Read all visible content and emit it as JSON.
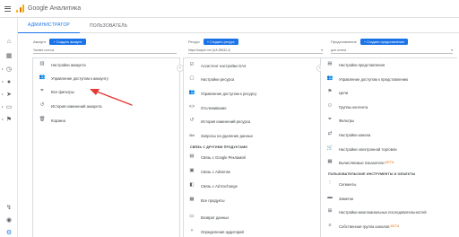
{
  "app": {
    "title": "Google Аналитика"
  },
  "tabs": [
    {
      "label": "АДМИНИСТРАТОР"
    },
    {
      "label": "ПОЛЬЗОВАТЕЛЬ"
    }
  ],
  "columns": {
    "account": {
      "label": "Аккаунт",
      "create_label": "Создать аккаунт",
      "selector": "Yandex.com.ua",
      "items": [
        {
          "label": "Настройки аккаунта",
          "icon": "building-icon"
        },
        {
          "label": "Управление доступом к аккаунту",
          "icon": "people-icon"
        },
        {
          "label": "Все фильтры",
          "icon": "filter-icon"
        },
        {
          "label": "История изменений аккаунта",
          "icon": "history-icon"
        },
        {
          "label": "Корзина",
          "icon": "trash-icon"
        }
      ]
    },
    "property": {
      "label": "Ресурс",
      "create_label": "Создать ресурс",
      "selector": "https://kazpm.net (UA-98432-2)",
      "items": [
        {
          "label": "Ассистент настройки GA4",
          "icon": "check-square-icon"
        },
        {
          "label": "Настройки ресурса",
          "icon": "square-icon"
        },
        {
          "label": "Управление доступом к ресурсу",
          "icon": "people-icon"
        },
        {
          "label": "Отслеживание",
          "icon": "code-icon"
        },
        {
          "label": "История изменений ресурса",
          "icon": "history-icon"
        },
        {
          "label": "Запросы на удаление данных",
          "icon": "dd-icon"
        }
      ],
      "section_title": "СВЯЗЬ С ДРУГИМИ ПРОДУКТАМИ",
      "linked_items": [
        {
          "label": "Связь с Google Рекламой",
          "icon": "ads-icon"
        },
        {
          "label": "Связь с AdSense",
          "icon": "adsense-icon"
        },
        {
          "label": "Связь с Ad Exchange",
          "icon": "ad-exchange-icon"
        },
        {
          "label": "Все продукты",
          "icon": "grid-icon"
        }
      ],
      "bottom_items": [
        {
          "label": "Возврат данных",
          "icon": "data-return-icon"
        },
        {
          "label": "Определения аудиторий",
          "icon": "audience-icon"
        }
      ]
    },
    "view": {
      "label": "Представление",
      "create_label": "Создать представление",
      "selector": "для отчета",
      "items": [
        {
          "label": "Настройки представления",
          "icon": "doc-icon"
        },
        {
          "label": "Управление доступом к представлению",
          "icon": "people-icon"
        },
        {
          "label": "Цели",
          "icon": "flag-icon"
        },
        {
          "label": "Группы контента",
          "icon": "content-group-icon"
        },
        {
          "label": "Фильтры",
          "icon": "filter-icon"
        },
        {
          "label": "Настройки канала",
          "icon": "channel-icon"
        },
        {
          "label": "Настройки электронной торговли",
          "icon": "cart-icon"
        },
        {
          "label": "Вычисляемые показатели",
          "icon": "calc-icon",
          "badge": "БЕТА"
        }
      ],
      "section_title": "ПОЛЬЗОВАТЕЛЬСКИЕ ИНСТРУМЕНТЫ И ОБЪЕКТЫ",
      "tool_items": [
        {
          "label": "Сегменты",
          "icon": "segments-icon"
        },
        {
          "label": "Заметки",
          "icon": "notes-icon"
        },
        {
          "label": "Настройки многоканальных последовательностей",
          "icon": "multichannel-icon"
        },
        {
          "label": "Собственная группа каналов",
          "icon": "custom-channel-icon",
          "badge": "БЕТА"
        }
      ]
    }
  },
  "colors": {
    "accent": "#1a73e8",
    "arrow": "#e53935",
    "beta": "#e8710a"
  }
}
